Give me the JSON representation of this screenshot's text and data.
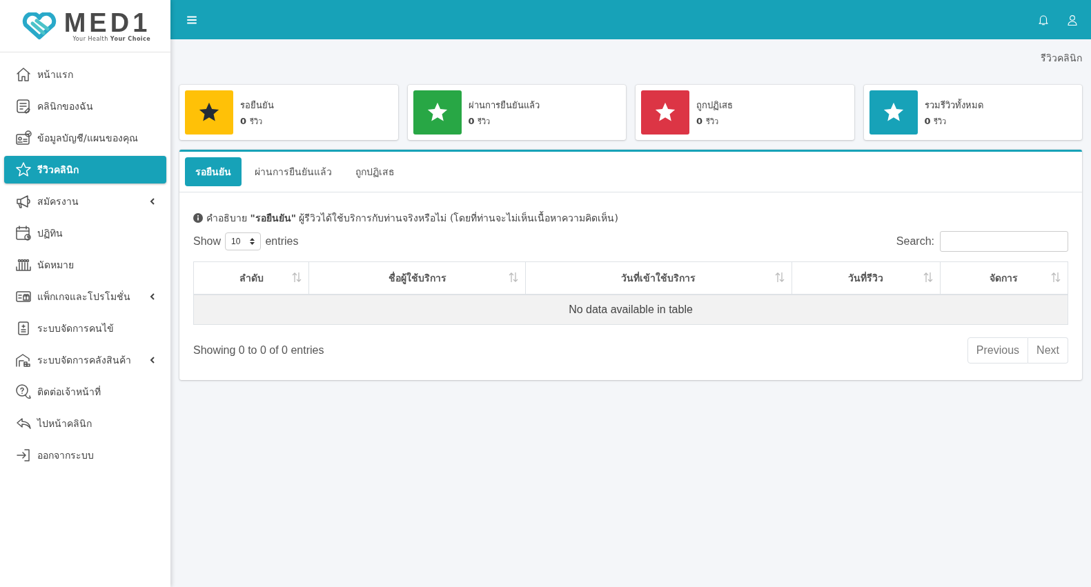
{
  "logo": {
    "name": "MED1",
    "tagline_regular": "Your Health",
    "tagline_bold": "Your Choice"
  },
  "sidebar": {
    "items": [
      {
        "label": "หน้าแรก",
        "selected": false,
        "has_submenu": false
      },
      {
        "label": "คลินิกของฉัน",
        "selected": false,
        "has_submenu": false
      },
      {
        "label": "ข้อมูลบัญชี/แผนของคุณ",
        "selected": false,
        "has_submenu": false
      },
      {
        "label": "รีวิวคลินิก",
        "selected": true,
        "has_submenu": false
      },
      {
        "label": "สมัครงาน",
        "selected": false,
        "has_submenu": true
      },
      {
        "label": "ปฏิทิน",
        "selected": false,
        "has_submenu": false
      },
      {
        "label": "นัดหมาย",
        "selected": false,
        "has_submenu": false
      },
      {
        "label": "แพ็กเกจและโปรโมชั่น",
        "selected": false,
        "has_submenu": true
      },
      {
        "label": "ระบบจัดการคนไข้",
        "selected": false,
        "has_submenu": false
      },
      {
        "label": "ระบบจัดการคลังสินค้า",
        "selected": false,
        "has_submenu": true
      },
      {
        "label": "ติดต่อเจ้าหน้าที่",
        "selected": false,
        "has_submenu": false
      },
      {
        "label": "ไปหน้าคลินิก",
        "selected": false,
        "has_submenu": false
      },
      {
        "label": "ออกจากระบบ",
        "selected": false,
        "has_submenu": false
      }
    ]
  },
  "breadcrumb": "รีวิวคลินิก",
  "stats": [
    {
      "label": "รอยืนยัน",
      "count": "0",
      "unit": "รีวิว",
      "color": "#ffc107"
    },
    {
      "label": "ผ่านการยืนยันแล้ว",
      "count": "0",
      "unit": "รีวิว",
      "color": "#28a745"
    },
    {
      "label": "ถูกปฏิเสธ",
      "count": "0",
      "unit": "รีวิว",
      "color": "#dc3545"
    },
    {
      "label": "รวมรีวิวทั้งหมด",
      "count": "0",
      "unit": "รีวิว",
      "color": "#17a2b8"
    }
  ],
  "tabs": [
    {
      "label": "รอยืนยัน",
      "selected": true
    },
    {
      "label": "ผ่านการยืนยันแล้ว",
      "selected": false
    },
    {
      "label": "ถูกปฏิเสธ",
      "selected": false
    }
  ],
  "description": "คำอธิบาย **\"รอยืนยัน\"** ผู้รีวิวได้ใช้บริการกับท่านจริงหรือไม่ (โดยที่ท่านจะไม่เห็นเนื้อหาความคิดเห็น)",
  "length": {
    "show": "Show",
    "value": "10",
    "entries": "entries"
  },
  "search": {
    "label": "Search:"
  },
  "table": {
    "columns": [
      "ลำดับ",
      "ชื่อผู้ใช้บริการ",
      "วันที่เข้าใช้บริการ",
      "วันที่รีวิว",
      "จัดการ"
    ],
    "empty": "No data available in table"
  },
  "info": "Showing 0 to 0 of 0 entries",
  "pagination": [
    {
      "label": "Previous",
      "disabled": true
    },
    {
      "label": "Next",
      "disabled": true
    }
  ]
}
